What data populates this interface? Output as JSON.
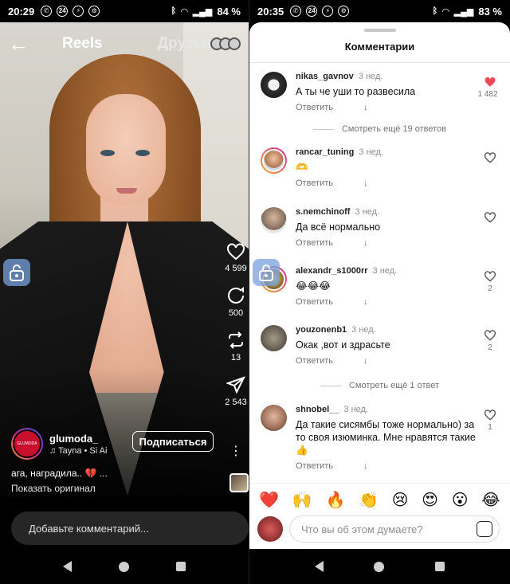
{
  "left": {
    "status": {
      "time": "20:29",
      "battery": "84 %",
      "notif_badge": "24"
    },
    "header": {
      "back": "←",
      "title": "Reels",
      "friends": "Друзья"
    },
    "actions": {
      "likes": "4 599",
      "comments": "500",
      "reposts": "13",
      "shares": "2 543"
    },
    "author": {
      "username": "glumoda_",
      "music": "♫ Tayna • Si Ai",
      "avatar_text": "GLUMODA"
    },
    "follow_label": "Подписаться",
    "caption": "ага, наградила.. 💔 ...",
    "show_original": "Показать оригинал",
    "comment_placeholder": "Добавьте комментарий..."
  },
  "right": {
    "status": {
      "time": "20:35",
      "battery": "83 %",
      "notif_badge": "24"
    },
    "sheet_title": "Комментарии",
    "comments": [
      {
        "user": "nikas_gavnov",
        "time": "3 нед.",
        "text": "А ты че уши то развесила",
        "reply": "Ответить",
        "likes": "1 482",
        "liked": true
      },
      {
        "user": "rancar_tuning",
        "time": "3 нед.",
        "text": "🫶",
        "reply": "Ответить",
        "likes": "",
        "liked": false
      },
      {
        "user": "s.nemchinoff",
        "time": "3 нед.",
        "text": "Да всё нормально",
        "reply": "Ответить",
        "likes": "",
        "liked": false
      },
      {
        "user": "alexandr_s1000rr",
        "time": "3 нед.",
        "text": "😂😂😂",
        "reply": "Ответить",
        "likes": "2",
        "liked": false
      },
      {
        "user": "youzonenb1",
        "time": "3 нед.",
        "text": "Окак ,вот и здрасьте",
        "reply": "Ответить",
        "likes": "2",
        "liked": false
      },
      {
        "user": "shnobel__",
        "time": "3 нед.",
        "text": "Да такие сисямбы тоже нормально) за то своя изюминка. Мне нравятся такие 👍",
        "reply": "Ответить",
        "likes": "1",
        "liked": false
      }
    ],
    "more_replies_1": "Смотреть ещё 19 ответов",
    "more_replies_2": "Смотреть ещё 1 ответ",
    "reactions": [
      "❤️",
      "🙌",
      "🔥",
      "👏",
      "😢",
      "😍",
      "😮",
      "😂"
    ],
    "input_placeholder": "Что вы об этом думаете?"
  },
  "colors": {
    "like_red": "#ed4956",
    "sheet_bg": "#ffffff",
    "muted": "#737373"
  }
}
